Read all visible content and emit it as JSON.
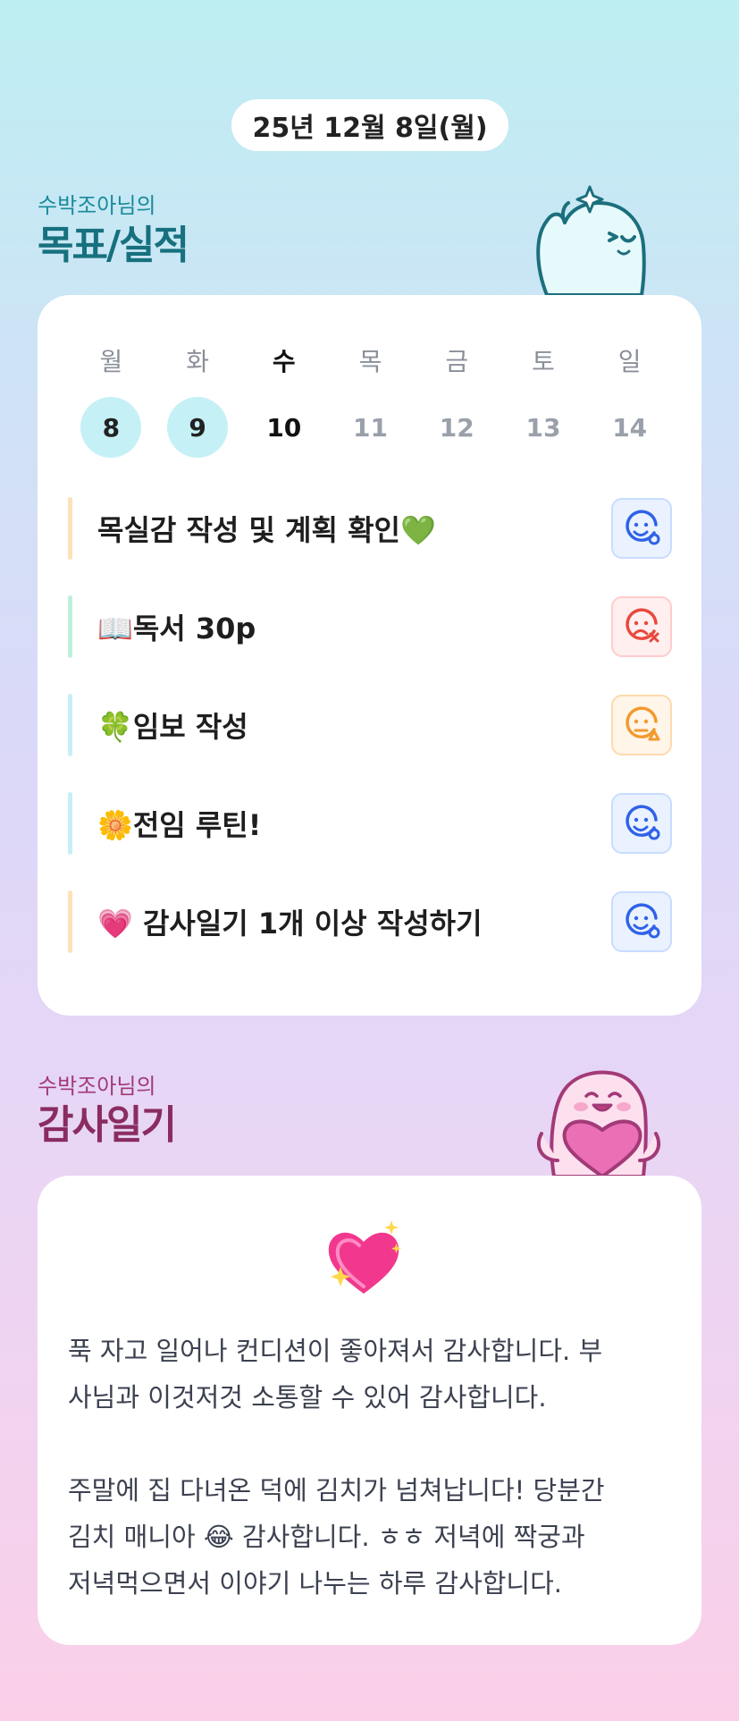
{
  "header": {
    "date": "25년 12월 8일(월)"
  },
  "goals_section": {
    "subtitle": "수박조아님의",
    "title": "목표/실적"
  },
  "week": [
    {
      "name": "월",
      "num": "8",
      "state": "done"
    },
    {
      "name": "화",
      "num": "9",
      "state": "done"
    },
    {
      "name": "수",
      "num": "10",
      "state": "today"
    },
    {
      "name": "목",
      "num": "11",
      "state": "future"
    },
    {
      "name": "금",
      "num": "12",
      "state": "future"
    },
    {
      "name": "토",
      "num": "13",
      "state": "future"
    },
    {
      "name": "일",
      "num": "14",
      "state": "future"
    }
  ],
  "goals": [
    {
      "label": "목실감 작성 및 계획 확인💚",
      "bar_color": "#fde1b8",
      "status": "good",
      "status_icon": "smile-check-icon"
    },
    {
      "label": "📖독서 30p",
      "bar_color": "#bff0dc",
      "status": "bad",
      "status_icon": "frown-x-icon"
    },
    {
      "label": "🍀임보 작성",
      "bar_color": "#c8eef6",
      "status": "partial",
      "status_icon": "neutral-triangle-icon"
    },
    {
      "label": "🌼전임 루틴!",
      "bar_color": "#c8eef6",
      "status": "good",
      "status_icon": "smile-check-icon"
    },
    {
      "label": "💗 감사일기 1개 이상 작성하기",
      "bar_color": "#fde1b8",
      "status": "good",
      "status_icon": "smile-check-icon"
    }
  ],
  "status_colors": {
    "good": "#2f62e8",
    "bad": "#e8493d",
    "partial": "#f29a2e"
  },
  "gratitude_section": {
    "subtitle": "수박조아님의",
    "title": "감사일기",
    "body": "푹 자고 일어나 컨디션이 좋아져서 감사합니다. 부\n사님과 이것저것 소통할 수 있어 감사합니다.\n\n주말에 집 다녀온 덕에 김치가 넘쳐납니다! 당분간\n김치 매니아 😂 감사합니다. ㅎㅎ 저녁에 짝궁과\n저녁먹으면서 이야기 나누는 하루 감사합니다."
  }
}
